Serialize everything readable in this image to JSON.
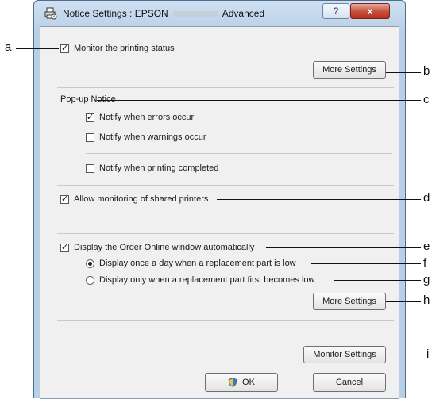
{
  "window": {
    "title_prefix": "Notice Settings : EPSON",
    "title_suffix": "Advanced",
    "help_label": "?",
    "close_label": "x"
  },
  "monitor": {
    "checkbox_label": "Monitor the printing status",
    "checked": true,
    "more_settings_label": "More Settings"
  },
  "popup": {
    "heading": "Pop-up Notice",
    "errors_label": "Notify when errors occur",
    "errors_checked": true,
    "warnings_label": "Notify when warnings occur",
    "warnings_checked": false,
    "completed_label": "Notify when printing completed",
    "completed_checked": false
  },
  "shared": {
    "label": "Allow monitoring of shared printers",
    "checked": true
  },
  "order": {
    "label": "Display the Order Online window automatically",
    "checked": true,
    "option_once_label": "Display once a day when a replacement part is low",
    "option_first_label": "Display only when a replacement part first becomes low",
    "selected_option": "once",
    "more_settings_label": "More Settings"
  },
  "monitor_settings_label": "Monitor Settings",
  "footer": {
    "ok_label": "OK",
    "cancel_label": "Cancel"
  },
  "annotations": {
    "a": "a",
    "b": "b",
    "c1": "c",
    "c2": "d",
    "e": "e",
    "f": "f",
    "g": "g",
    "h": "h",
    "i": "i"
  }
}
